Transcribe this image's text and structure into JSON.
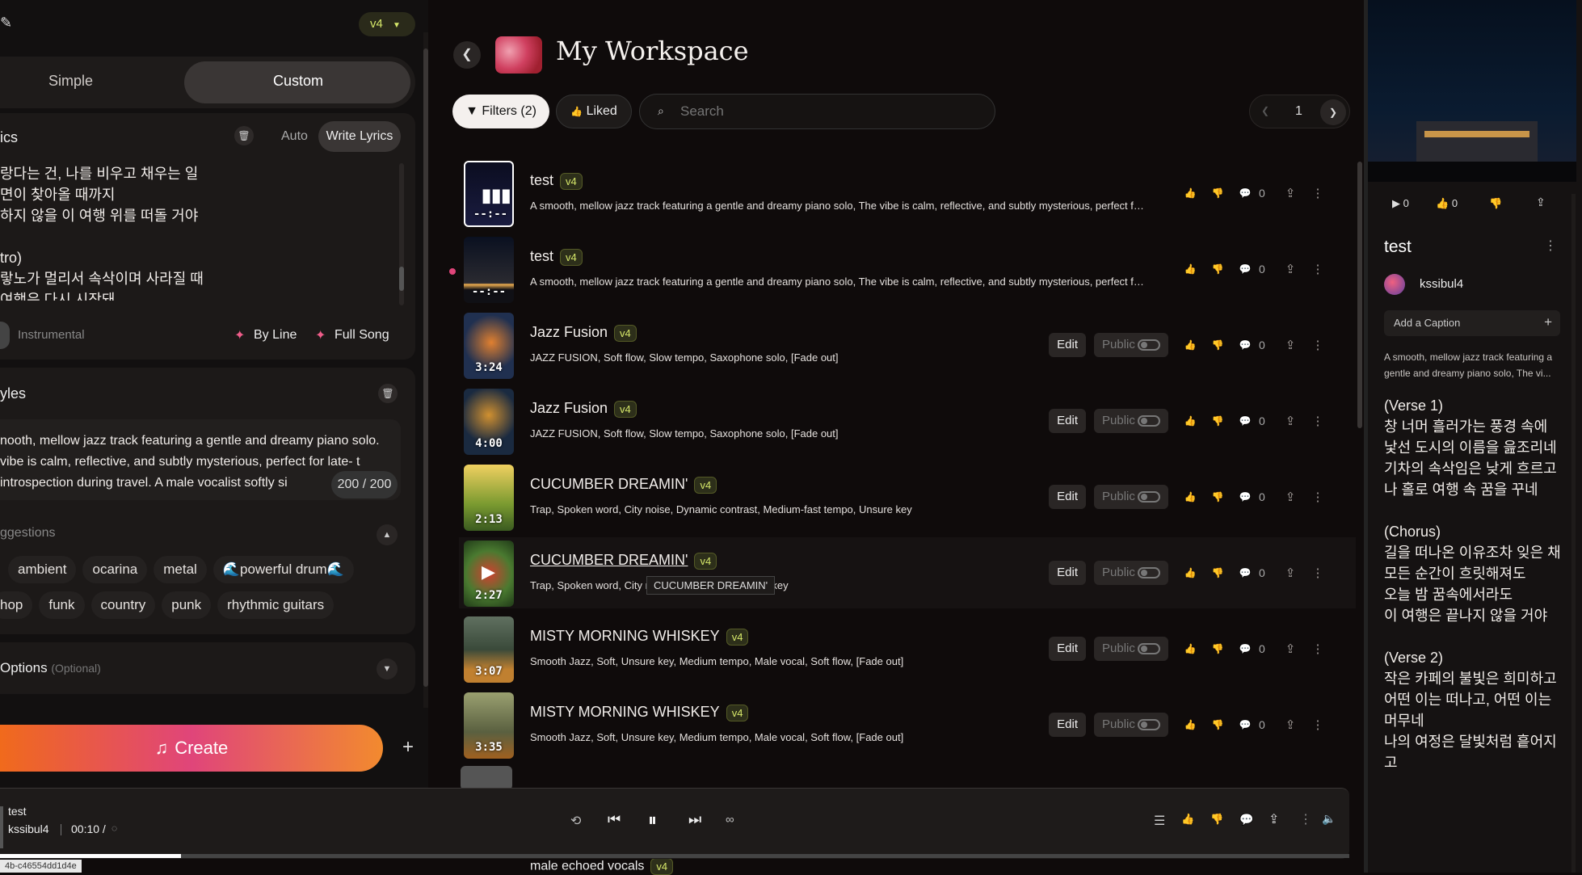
{
  "left": {
    "version": "v4",
    "modes": [
      "Simple",
      "Custom"
    ],
    "lyrics": {
      "header": "ics",
      "auto": "Auto",
      "write": "Write Lyrics",
      "lines": [
        "랑다는 건, 나를 비우고 채우는 일",
        "면이 찾아올 때까지",
        "하지 않을 이 여행 위를 떠돌 거야",
        "",
        "tro)",
        "랗노가 멀리서 속삭이며 사라질 때",
        "여행은 다시 시작돼"
      ],
      "instrumental": "Instrumental",
      "by_line": "By Line",
      "full_song": "Full Song"
    },
    "styles": {
      "header": "yles",
      "text": "nooth, mellow jazz track featuring a gentle and dreamy piano solo. vibe is calm, reflective, and subtly mysterious, perfect for late- t introspection during travel. A male vocalist softly si",
      "counter": "200 / 200",
      "suggestions_label": "ggestions",
      "tags_row1": [
        "ambient",
        "ocarina",
        "metal",
        "🌊powerful drum🌊"
      ],
      "tags_row2": [
        "hop",
        "funk",
        "country",
        "punk",
        "rhythmic guitars"
      ]
    },
    "options": {
      "label": "Options",
      "optional": "(Optional)"
    },
    "create": "Create"
  },
  "workspace": {
    "title": "My Workspace",
    "filters": "Filters (2)",
    "liked": "Liked",
    "search_placeholder": "Search",
    "page": "1"
  },
  "songs": [
    {
      "title": "test",
      "tag": "v4",
      "desc": "A smooth, mellow jazz track featuring a gentle and dreamy piano solo, The vibe is calm, reflective, and subtly mysterious, perfect for late-...",
      "dur": "--:--",
      "count": "0",
      "editable": false,
      "liked": false
    },
    {
      "title": "test",
      "tag": "v4",
      "desc": "A smooth, mellow jazz track featuring a gentle and dreamy piano solo, The vibe is calm, reflective, and subtly mysterious, perfect for late-...",
      "dur": "--:--",
      "count": "0",
      "editable": false,
      "liked": false
    },
    {
      "title": "Jazz Fusion",
      "tag": "v4",
      "desc": "JAZZ FUSION, Soft flow, Slow tempo, Saxophone solo, [Fade out]",
      "dur": "3:24",
      "count": "0",
      "editable": true,
      "liked": false
    },
    {
      "title": "Jazz Fusion",
      "tag": "v4",
      "desc": "JAZZ FUSION, Soft flow, Slow tempo, Saxophone solo, [Fade out]",
      "dur": "4:00",
      "count": "0",
      "editable": true,
      "liked": false
    },
    {
      "title": "CUCUMBER DREAMIN'",
      "tag": "v4",
      "desc": "Trap, Spoken word, City noise, Dynamic contrast, Medium-fast tempo, Unsure key",
      "dur": "2:13",
      "count": "0",
      "editable": true,
      "liked": true
    },
    {
      "title": "CUCUMBER DREAMIN'",
      "tag": "v4",
      "desc": "Trap, Spoken word, City no                                   ium-fast tempo, Unsure key",
      "dur": "2:27",
      "count": "0",
      "editable": true,
      "liked": true
    },
    {
      "title": "MISTY MORNING WHISKEY",
      "tag": "v4",
      "desc": "Smooth Jazz, Soft, Unsure key, Medium tempo, Male vocal, Soft flow, [Fade out]",
      "dur": "3:07",
      "count": "0",
      "editable": true,
      "liked": false
    },
    {
      "title": "MISTY MORNING WHISKEY",
      "tag": "v4",
      "desc": "Smooth Jazz, Soft, Unsure key, Medium tempo, Male vocal, Soft flow, [Fade out]",
      "dur": "3:35",
      "count": "0",
      "editable": true,
      "liked": false
    }
  ],
  "row_labels": {
    "edit": "Edit",
    "public": "Public"
  },
  "tooltip": "CUCUMBER DREAMIN'",
  "partial_row_title": "male echoed vocals",
  "partial_row_tag": "v4",
  "player": {
    "title": "test",
    "artist": "kssibul4",
    "time": "00:10 /",
    "url": "4b-c46554dd1d4e"
  },
  "right": {
    "play_count": "0",
    "like_count": "0",
    "title": "test",
    "artist": "kssibul4",
    "caption_placeholder": "Add a Caption",
    "desc": "A smooth, mellow jazz track featuring a gentle and dreamy piano solo, The vi...",
    "lyrics": [
      "(Verse 1)",
      "창 너머 흘러가는 풍경 속에",
      "낯선 도시의 이름을 읊조리네",
      "기차의 속삭임은 낮게 흐르고",
      "나 홀로 여행 속 꿈을 꾸네",
      "",
      "(Chorus)",
      "길을 떠나온 이유조차 잊은 채",
      "모든 순간이 흐릿해져도",
      "오늘 밤 꿈속에서라도",
      "이 여행은 끝나지 않을 거야",
      "",
      "(Verse 2)",
      "작은 카페의 불빛은 희미하고",
      "어떤 이는 떠나고, 어떤 이는 머무네",
      "나의 여정은 달빛처럼 흩어지고"
    ]
  },
  "colors": {
    "accent_create_start": "#e0457a",
    "accent_create_end": "#f28a2e",
    "tag_text": "#d6e86a",
    "bg": "#0f0b0b"
  }
}
